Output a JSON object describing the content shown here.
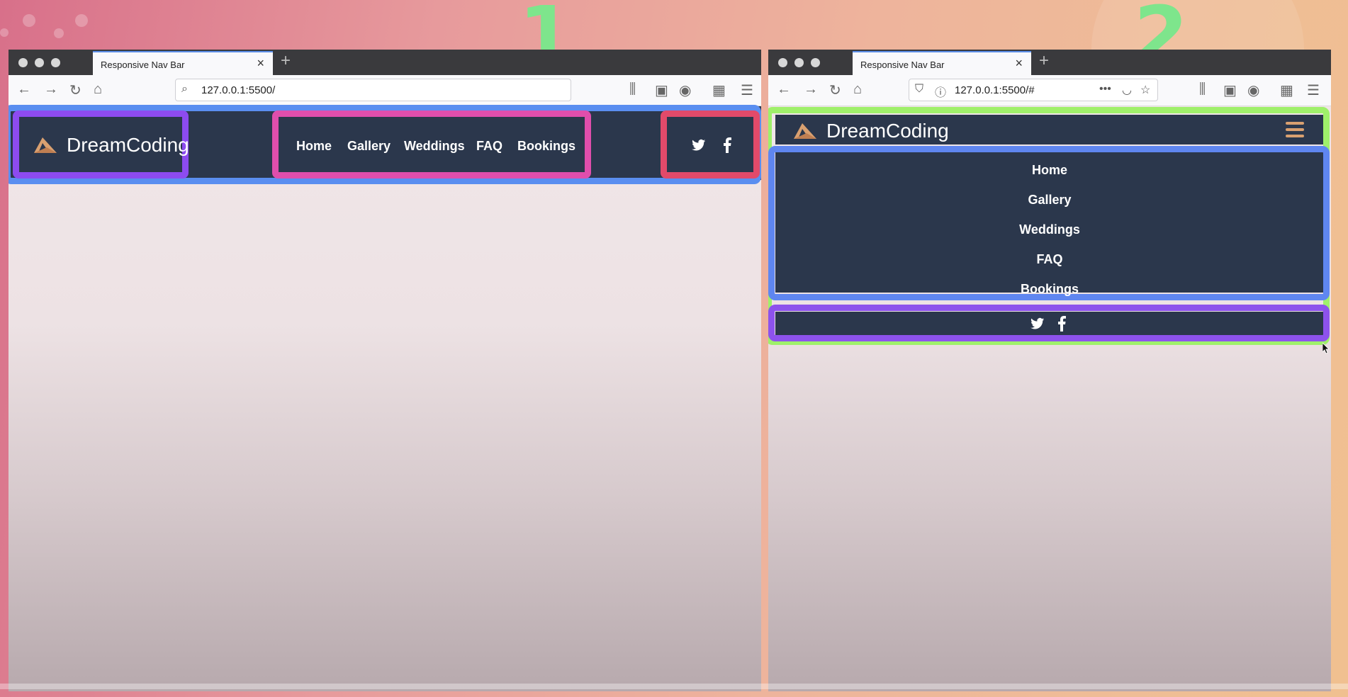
{
  "annotations": {
    "left": "1",
    "right": "2"
  },
  "left_window": {
    "tab_title": "Responsive Nav Bar",
    "url": "127.0.0.1:5500/",
    "brand": "DreamCoding",
    "links": [
      "Home",
      "Gallery",
      "Weddings",
      "FAQ",
      "Bookings"
    ]
  },
  "right_window": {
    "tab_title": "Responsive Nav Bar",
    "url": "127.0.0.1:5500/#",
    "brand": "DreamCoding",
    "links": [
      "Home",
      "Gallery",
      "Weddings",
      "FAQ",
      "Bookings"
    ]
  },
  "icons": {
    "twitter": "twitter-icon",
    "facebook": "facebook-icon",
    "hamburger": "hamburger-menu-icon",
    "logo": "logo-icon"
  },
  "colors": {
    "navbar_bg": "#2b374c",
    "logo_accent": "#d9a070",
    "annotation_green": "#7ee58c"
  }
}
